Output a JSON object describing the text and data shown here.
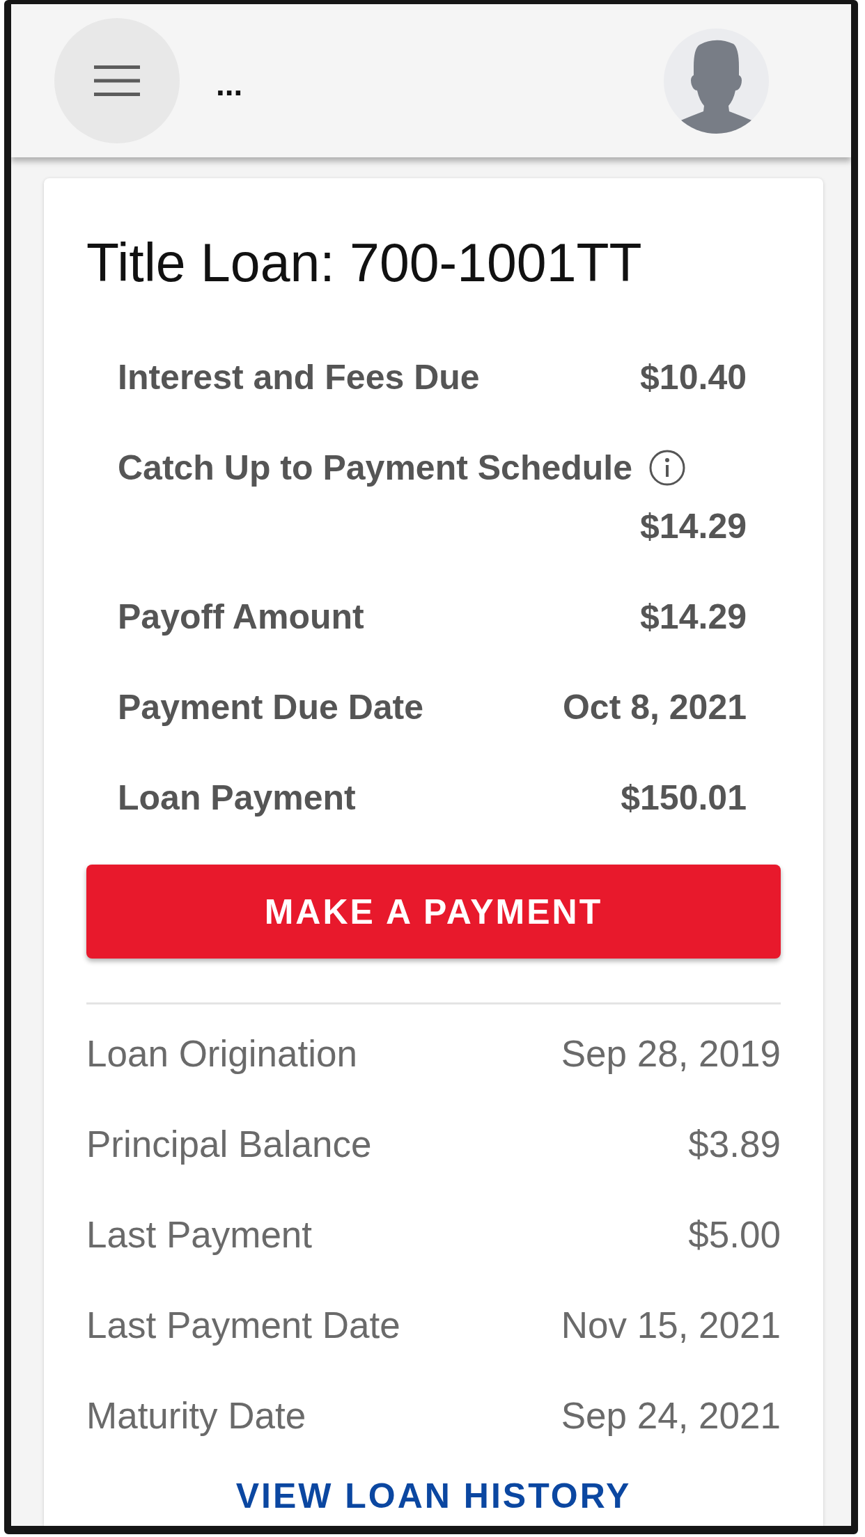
{
  "app_bar": {
    "title": "..."
  },
  "loan_card": {
    "title": "Title Loan: 700-1001TT",
    "summary_rows": [
      {
        "label": "Interest and Fees Due",
        "value": "$10.40",
        "info": false
      },
      {
        "label": "Catch Up to Payment Schedule",
        "value": "$14.29",
        "info": true
      },
      {
        "label": "Payoff Amount",
        "value": "$14.29",
        "info": false
      },
      {
        "label": "Payment Due Date",
        "value": "Oct 8, 2021",
        "info": false
      },
      {
        "label": "Loan Payment",
        "value": "$150.01",
        "info": false
      }
    ],
    "payment_button": "MAKE A PAYMENT",
    "detail_rows": [
      {
        "label": "Loan Origination",
        "value": "Sep 28, 2019"
      },
      {
        "label": "Principal Balance",
        "value": "$3.89"
      },
      {
        "label": "Last Payment",
        "value": "$5.00"
      },
      {
        "label": "Last Payment Date",
        "value": "Nov 15, 2021"
      },
      {
        "label": "Maturity Date",
        "value": "Sep 24, 2021"
      }
    ],
    "history_link": "VIEW LOAN HISTORY"
  }
}
